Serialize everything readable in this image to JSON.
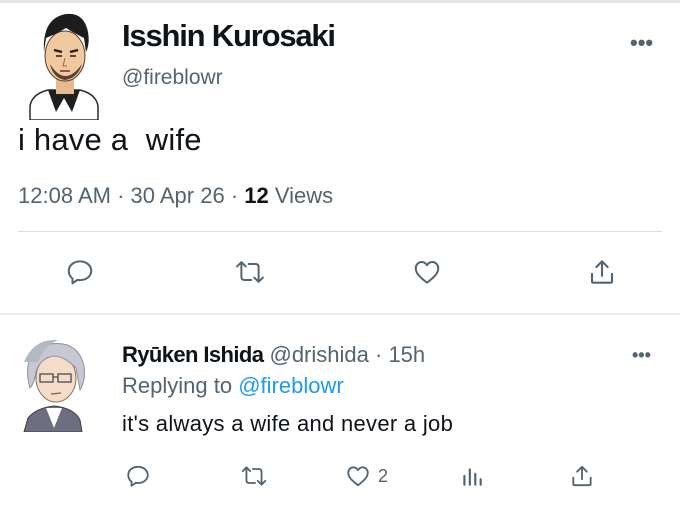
{
  "main_tweet": {
    "author_name": "Isshin Kurosaki",
    "handle": "@fireblowr",
    "more_label": "•••",
    "text": "i have a  wife",
    "time": "12:08 AM",
    "date": "30 Apr 26",
    "separator": " · ",
    "views_count": "12",
    "views_label": " Views",
    "actions": [
      "reply-icon",
      "retweet-icon",
      "like-icon",
      "share-icon"
    ]
  },
  "reply_tweet": {
    "author_name": "Ryūken Ishida",
    "handle": "@drishida",
    "age": "15h",
    "separator": " · ",
    "more_label": "•••",
    "replying_prefix": "Replying to ",
    "replying_handle": "@fireblowr",
    "text": "it's always a wife and never a job",
    "like_count": "2",
    "actions": [
      "reply-icon",
      "retweet-icon",
      "like-icon",
      "analytics-icon",
      "share-icon"
    ]
  },
  "colors": {
    "text_primary": "#0f1419",
    "text_secondary": "#536471",
    "link": "#1d9bf0",
    "divider": "#d9dee2"
  }
}
